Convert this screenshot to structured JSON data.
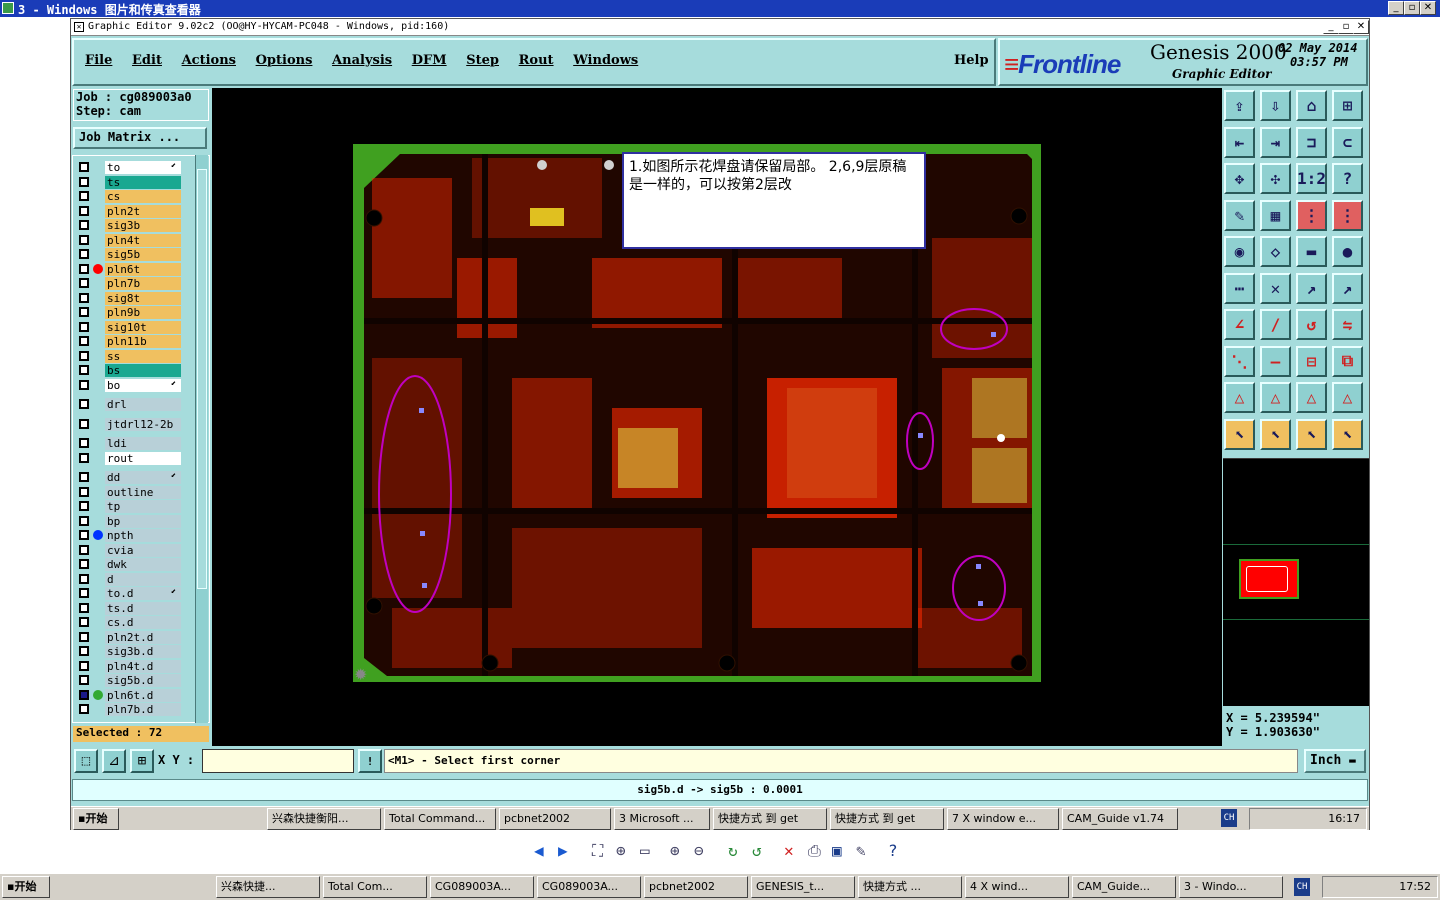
{
  "viewer_title": "3 - Windows 图片和传真查看器",
  "app": {
    "title": "Graphic Editor 9.02c2  (OO@HY-HYCAM-PC048 - Windows, pid:160)",
    "menu": [
      "File",
      "Edit",
      "Actions",
      "Options",
      "Analysis",
      "DFM",
      "Step",
      "Rout",
      "Windows"
    ],
    "help": "Help",
    "brand": "Frontline",
    "product": "Genesis 2000",
    "product_sub": "Graphic Editor",
    "date": "02 May 2014",
    "time": "03:57 PM"
  },
  "job": {
    "job_label": "Job : cg089003a0",
    "step_label": "Step: cam",
    "matrix_button": "Job Matrix ..."
  },
  "layers": [
    {
      "name": "to",
      "color": "#ffffff",
      "dot": "",
      "arrow": true
    },
    {
      "name": "ts",
      "color": "#1aa891",
      "dot": ""
    },
    {
      "name": "cs",
      "color": "#f0c060",
      "dot": ""
    },
    {
      "name": "pln2t",
      "color": "#f0c060",
      "dot": ""
    },
    {
      "name": "sig3b",
      "color": "#f0c060",
      "dot": ""
    },
    {
      "name": "pln4t",
      "color": "#f0c060",
      "dot": ""
    },
    {
      "name": "sig5b",
      "color": "#f0c060",
      "dot": ""
    },
    {
      "name": "pln6t",
      "color": "#f0c060",
      "dot": "#ff0000"
    },
    {
      "name": "pln7b",
      "color": "#f0c060",
      "dot": ""
    },
    {
      "name": "sig8t",
      "color": "#f0c060",
      "dot": ""
    },
    {
      "name": "pln9b",
      "color": "#f0c060",
      "dot": ""
    },
    {
      "name": "sig10t",
      "color": "#f0c060",
      "dot": ""
    },
    {
      "name": "pln11b",
      "color": "#f0c060",
      "dot": ""
    },
    {
      "name": "ss",
      "color": "#f0c060",
      "dot": ""
    },
    {
      "name": "bs",
      "color": "#1aa891",
      "dot": ""
    },
    {
      "name": "bo",
      "color": "#ffffff",
      "dot": "",
      "arrow": true
    },
    {
      "name": "drl",
      "color": "#b8d0d8",
      "dot": "",
      "gap": true
    },
    {
      "name": "jtdrl12-2b",
      "color": "#b8d0d8",
      "dot": "",
      "gap": true
    },
    {
      "name": "ldi",
      "color": "#b8d0d8",
      "dot": "",
      "gap": true
    },
    {
      "name": "rout",
      "color": "#ffffff",
      "dot": ""
    },
    {
      "name": "dd",
      "color": "#b8d0d8",
      "dot": "",
      "arrow": true,
      "gap": true
    },
    {
      "name": "outline",
      "color": "#b8d0d8",
      "dot": ""
    },
    {
      "name": "tp",
      "color": "#b8d0d8",
      "dot": ""
    },
    {
      "name": "bp",
      "color": "#b8d0d8",
      "dot": ""
    },
    {
      "name": "npth",
      "color": "#b8d0d8",
      "dot": "#0033ff"
    },
    {
      "name": "cvia",
      "color": "#b8d0d8",
      "dot": ""
    },
    {
      "name": "dwk",
      "color": "#b8d0d8",
      "dot": ""
    },
    {
      "name": "d",
      "color": "#b8d0d8",
      "dot": ""
    },
    {
      "name": "to.d",
      "color": "#b8d0d8",
      "dot": "",
      "arrow": true
    },
    {
      "name": "ts.d",
      "color": "#b8d0d8",
      "dot": ""
    },
    {
      "name": "cs.d",
      "color": "#b8d0d8",
      "dot": ""
    },
    {
      "name": "pln2t.d",
      "color": "#b8d0d8",
      "dot": ""
    },
    {
      "name": "sig3b.d",
      "color": "#b8d0d8",
      "dot": ""
    },
    {
      "name": "pln4t.d",
      "color": "#b8d0d8",
      "dot": ""
    },
    {
      "name": "sig5b.d",
      "color": "#b8d0d8",
      "dot": ""
    },
    {
      "name": "pln6t.d",
      "color": "#b8d0d8",
      "dot": "#33aa33",
      "selected": true
    },
    {
      "name": "pln7b.d",
      "color": "#b8d0d8",
      "dot": ""
    }
  ],
  "selected_label": "Selected : 72",
  "note": "1.如图所示花焊盘请保留局部。 2,6,9层原稿是一样的，可以按第2层改",
  "coords": {
    "x": "X  =  5.239594\"",
    "y": "Y  =  1.903630\""
  },
  "xy_label": "X Y :",
  "prompt": "<M1> - Select first corner",
  "units": "Inch",
  "status": "sig5b.d -> sig5b : 0.0001",
  "inner_taskbar": {
    "start": "开始",
    "items": [
      "兴森快捷衡阳...",
      "Total Command...",
      "pcbnet2002",
      "3 Microsoft ...",
      "快捷方式 到 get",
      "快捷方式 到 get",
      "7 X window e...",
      "CAM_Guide v1.74"
    ],
    "lang": "CH",
    "clock": "16:17"
  },
  "outer_taskbar": {
    "start": "开始",
    "items": [
      "兴森快捷...",
      "Total Com...",
      "CG089003A...",
      "CG089003A...",
      "pcbnet2002",
      "GENESIS_t...",
      "快捷方式 ...",
      "4 X wind...",
      "CAM_Guide...",
      "3 - Windo..."
    ],
    "lang": "CH",
    "clock": "17:52"
  }
}
